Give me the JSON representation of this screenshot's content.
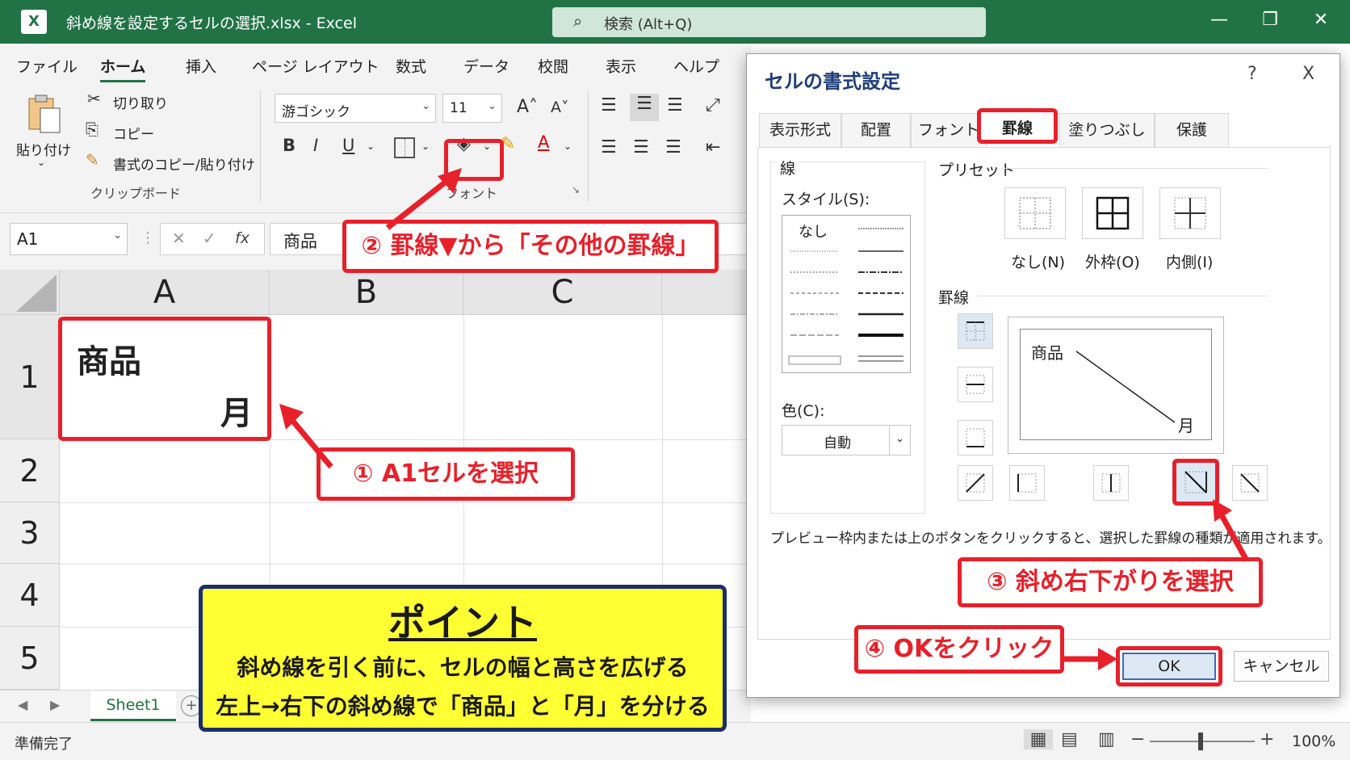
{
  "window": {
    "title": "斜め線を設定するセルの選択.xlsx  -  Excel",
    "search": "検索 (Alt+Q)"
  },
  "menu": [
    "ファイル",
    "ホーム",
    "挿入",
    "ページ レイアウト",
    "数式",
    "データ",
    "校閲",
    "表示",
    "ヘルプ"
  ],
  "ribbon": {
    "paste": "貼り付け",
    "cut": "切り取り",
    "copy": "コピー",
    "format_painter": "書式のコピー/貼り付け",
    "clipboard_group": "クリップボード",
    "font_name": "游ゴシック",
    "font_size": "11",
    "font_group": "フォント",
    "bold": "B",
    "italic": "I",
    "underline": "U",
    "font_color": "A"
  },
  "formula_bar": {
    "name_box": "A1",
    "fx": "fx",
    "content": "商品"
  },
  "sheet": {
    "columns": [
      "A",
      "B",
      "C"
    ],
    "rows": [
      "1",
      "2",
      "3",
      "4",
      "5"
    ],
    "a1_top": "商品",
    "a1_bottom": "月",
    "tab": "Sheet1"
  },
  "status": {
    "ready": "準備完了",
    "zoom": "100%"
  },
  "dialog": {
    "title": "セルの書式設定",
    "help": "?",
    "close": "X",
    "tabs": [
      "表示形式",
      "配置",
      "フォント",
      "罫線",
      "塗りつぶし",
      "保護"
    ],
    "line_section": "線",
    "style_label": "スタイル(S):",
    "none_style": "なし",
    "color_label": "色(C):",
    "color_value": "自動",
    "preset_section": "プリセット",
    "preset_none": "なし(N)",
    "preset_outline": "外枠(O)",
    "preset_inside": "内側(I)",
    "border_section": "罫線",
    "preview_top": "商品",
    "preview_bottom": "月",
    "hint": "プレビュー枠内または上のボタンをクリックすると、選択した罫線の種類が適用されます。",
    "ok": "OK",
    "cancel": "キャンセル"
  },
  "annotations": {
    "step1": "① A1セルを選択",
    "step2": "② 罫線▼から「その他の罫線」",
    "step3": "③ 斜め右下がりを選択",
    "step4": "④ OKをクリック",
    "point_title": "ポイント",
    "point_line1": "斜め線を引く前に、セルの幅と高さを広げる",
    "point_line2": "左上→右下の斜め線で「商品」と「月」を分ける"
  },
  "colors": {
    "excel_green": "#217346",
    "highlight_red": "#e8202a",
    "point_yellow": "#ffff33",
    "point_border": "#1a2e6b"
  }
}
